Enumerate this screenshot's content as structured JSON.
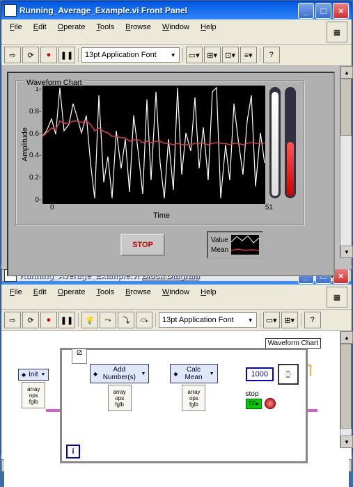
{
  "windows": {
    "front_panel": {
      "title": "Running_Average_Example.vi Front Panel",
      "menus": [
        "File",
        "Edit",
        "Operate",
        "Tools",
        "Browse",
        "Window",
        "Help"
      ],
      "font": "13pt Application Font"
    },
    "block_diagram": {
      "title": "Running_Average_Example.vi Block Diagram",
      "menus": [
        "File",
        "Edit",
        "Operate",
        "Tools",
        "Browse",
        "Window",
        "Help"
      ],
      "font": "13pt Application Font"
    }
  },
  "chart": {
    "label": "Waveform Chart",
    "xlabel": "Time",
    "ylabel": "Amplitude",
    "x_ticks": [
      "0",
      "51"
    ],
    "y_ticks": [
      "0-",
      "0.2-",
      "0.4-",
      "0.6-",
      "0.8-",
      "1-"
    ],
    "stop_label": "STOP",
    "legend": {
      "value": "Value",
      "mean": "Mean"
    }
  },
  "chart_data": {
    "type": "line",
    "title": "Waveform Chart",
    "xlabel": "Time",
    "ylabel": "Amplitude",
    "xlim": [
      0,
      51
    ],
    "ylim": [
      0,
      1
    ],
    "x": [
      0,
      1,
      2,
      3,
      4,
      5,
      6,
      7,
      8,
      9,
      10,
      11,
      12,
      13,
      14,
      15,
      16,
      17,
      18,
      19,
      20,
      21,
      22,
      23,
      24,
      25,
      26,
      27,
      28,
      29,
      30,
      31,
      32,
      33,
      34,
      35,
      36,
      37,
      38,
      39,
      40,
      41,
      42,
      43,
      44,
      45,
      46,
      47,
      48,
      49,
      50,
      51
    ],
    "series": [
      {
        "name": "Value",
        "color": "#ffffff",
        "values": [
          0.57,
          0.62,
          0.72,
          0.59,
          0.98,
          0.62,
          0.67,
          0.85,
          0.73,
          0.6,
          0.75,
          0.35,
          0.05,
          0.92,
          0.18,
          0.4,
          0.05,
          0.62,
          0.3,
          0.55,
          0.1,
          0.75,
          0.42,
          0.08,
          0.88,
          0.2,
          0.95,
          0.35,
          0.05,
          0.55,
          0.12,
          0.98,
          0.25,
          0.6,
          0.45,
          0.9,
          0.3,
          0.65,
          0.2,
          0.95,
          0.98,
          0.05,
          0.5,
          0.2,
          0.85,
          0.55,
          0.25,
          0.7,
          0.92,
          0.15,
          0.6,
          0.35
        ]
      },
      {
        "name": "Mean",
        "color": "#d04040",
        "values": [
          0.57,
          0.6,
          0.64,
          0.63,
          0.7,
          0.68,
          0.68,
          0.7,
          0.7,
          0.69,
          0.7,
          0.67,
          0.62,
          0.64,
          0.61,
          0.6,
          0.57,
          0.57,
          0.56,
          0.56,
          0.53,
          0.54,
          0.54,
          0.52,
          0.53,
          0.52,
          0.53,
          0.53,
          0.51,
          0.51,
          0.5,
          0.51,
          0.5,
          0.5,
          0.5,
          0.51,
          0.51,
          0.51,
          0.5,
          0.51,
          0.52,
          0.51,
          0.51,
          0.5,
          0.51,
          0.51,
          0.5,
          0.51,
          0.52,
          0.51,
          0.51,
          0.51
        ]
      }
    ]
  },
  "block": {
    "chart_label": "Waveform Chart",
    "init": "Init",
    "add": "Add Number(s)",
    "calc": "Calc Mean",
    "delay": "1000",
    "stop": "stop",
    "node_text": "array\nops\nfglb"
  }
}
